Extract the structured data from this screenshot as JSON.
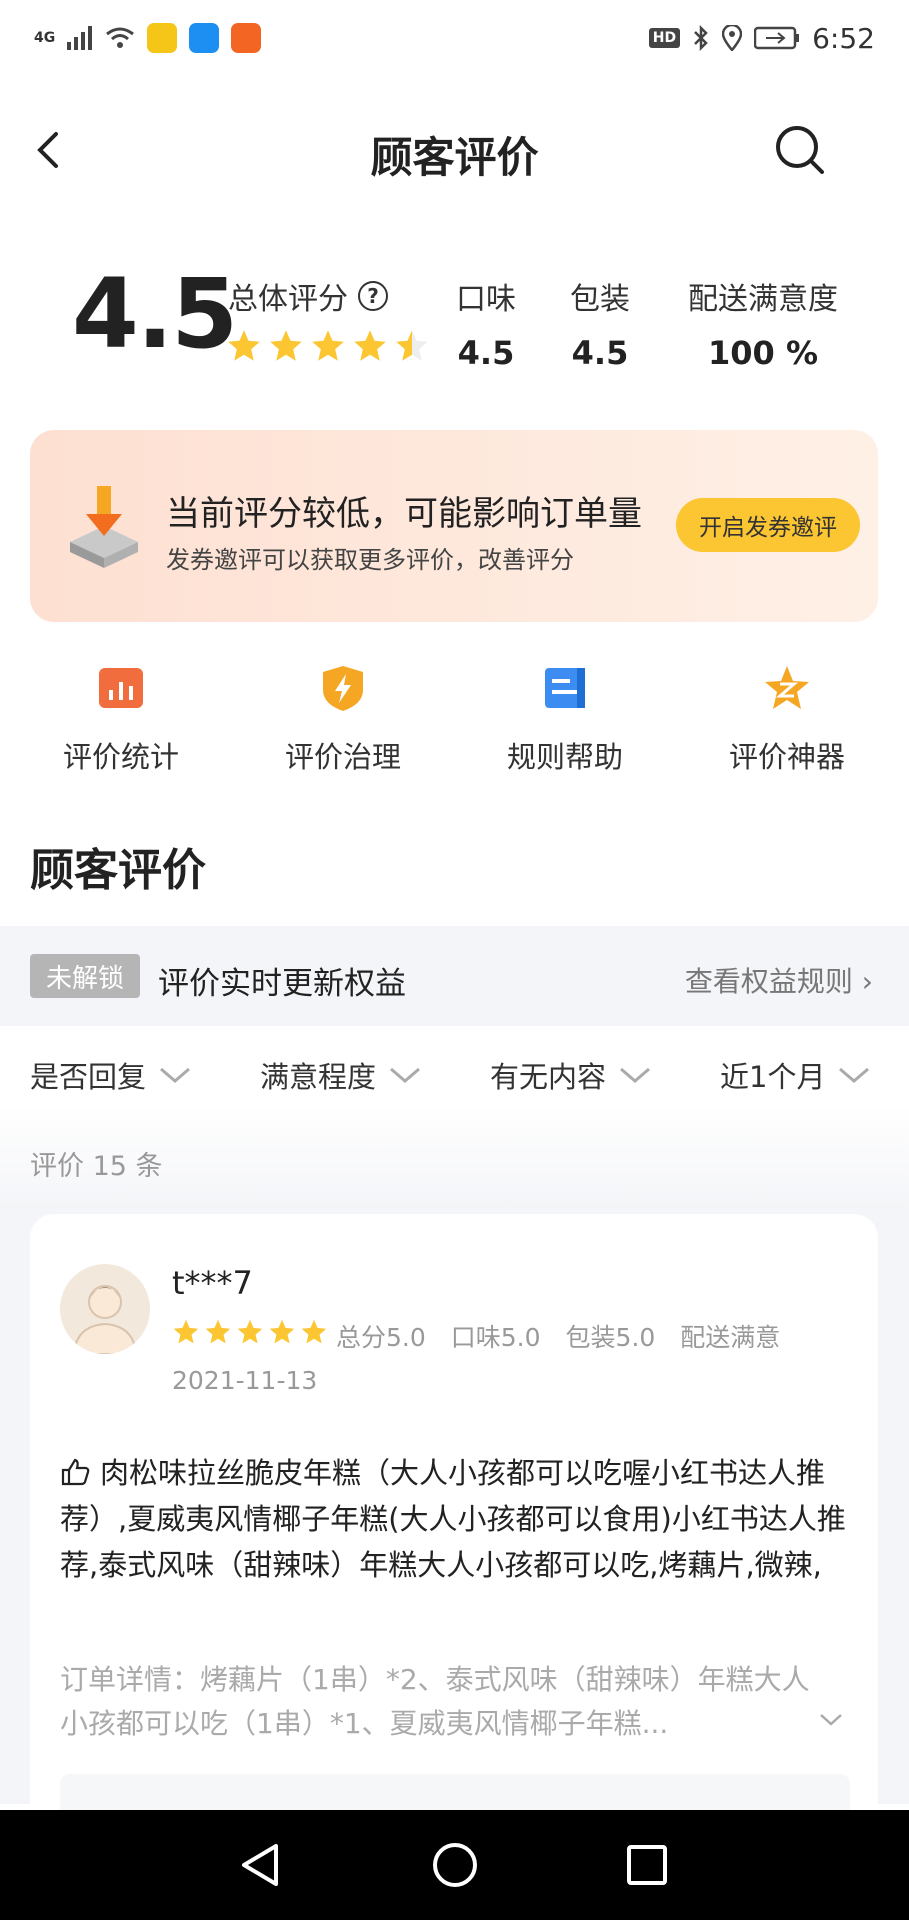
{
  "status": {
    "time": "6:52",
    "network": "4G",
    "hd": "HD"
  },
  "nav": {
    "title": "顾客评价"
  },
  "summary": {
    "score": "4.5",
    "overall_label": "总体评分",
    "help": "?",
    "star_rating": 4.5,
    "taste_label": "口味",
    "taste_value": "4.5",
    "pack_label": "包装",
    "pack_value": "4.5",
    "delivery_label": "配送满意度",
    "delivery_value": "100 %"
  },
  "banner": {
    "headline": "当前评分较低，可能影响订单量",
    "sub": "发券邀评可以获取更多评价，改善评分",
    "button": "开启发券邀评"
  },
  "tools": [
    {
      "label": "评价统计",
      "icon": "bar-chart-icon",
      "color": "#f26d3d"
    },
    {
      "label": "评价治理",
      "icon": "shield-bolt-icon",
      "color": "#f5a623"
    },
    {
      "label": "规则帮助",
      "icon": "document-icon",
      "color": "#3d8cf2"
    },
    {
      "label": "评价神器",
      "icon": "star-badge-icon",
      "color": "#f5a623"
    }
  ],
  "section_title": "顾客评价",
  "unlock": {
    "badge": "未解锁",
    "text": "评价实时更新权益",
    "link": "查看权益规则 ›"
  },
  "filters": [
    "是否回复",
    "满意程度",
    "有无内容",
    "近1个月"
  ],
  "count": "评价 15 条",
  "review": {
    "user": "t***7",
    "stars": 5,
    "meta": "总分5.0　口味5.0　包装5.0　配送满意",
    "date": "2021-11-13",
    "content": "肉松味拉丝脆皮年糕（大人小孩都可以吃喔小红书达人推荐）,夏威夷风情椰子年糕(大人小孩都可以食用)小红书达人推荐,泰式风味（甜辣味）年糕大人小孩都可以吃,烤藕片,微辣,",
    "order": "订单详情：烤藕片（1串）*2、泰式风味（甜辣味）年糕大人小孩都可以吃（1串）*1、夏威夷风情椰子年糕..."
  },
  "colors": {
    "star": "#fcc532",
    "accent": "#fcc532"
  }
}
